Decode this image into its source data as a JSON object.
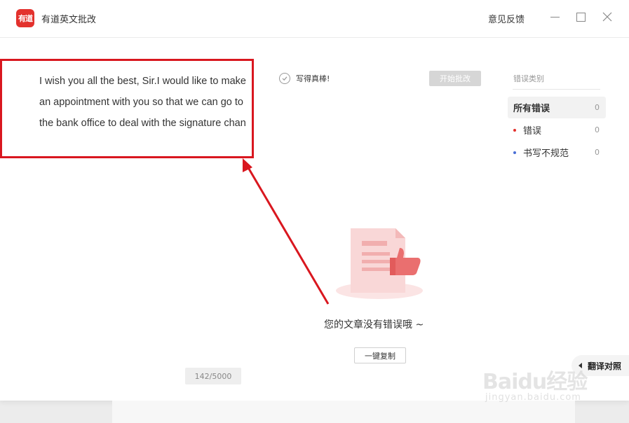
{
  "titlebar": {
    "logo_text": "有道",
    "app_title": "有道英文批改",
    "feedback_label": "意见反馈"
  },
  "editor": {
    "text": "I wish you all the best, Sir.I would like to make an appointment with you so that we can go to the bank office to deal with the signature chan",
    "char_count": "142/5000"
  },
  "review": {
    "good_label": "写得真棒!",
    "start_button": "开始批改",
    "no_error_text": "您的文章没有错误哦 ~",
    "copy_button": "一键复制"
  },
  "sidebar": {
    "title": "错误类别",
    "categories": [
      {
        "label": "所有错误",
        "count": "0",
        "dot_color": ""
      },
      {
        "label": "错误",
        "count": "0",
        "dot_color": "#e3312d"
      },
      {
        "label": "书写不规范",
        "count": "0",
        "dot_color": "#4a6fd6"
      }
    ]
  },
  "translate_tab": "翻译对照",
  "watermark": {
    "main": "Baidu经验",
    "sub": "jingyan.baidu.com"
  },
  "colors": {
    "brand": "#e3312d",
    "annotation": "#d9171f"
  }
}
